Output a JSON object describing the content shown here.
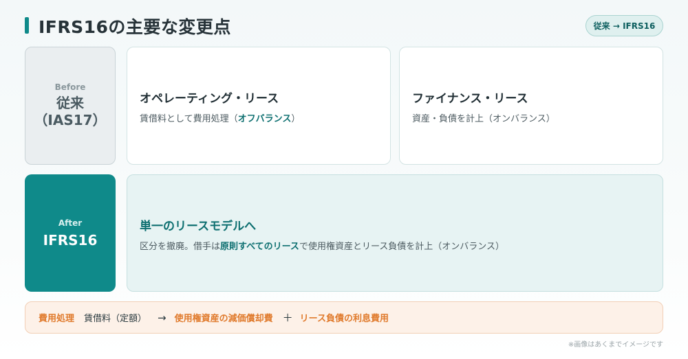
{
  "header": {
    "title": "IFRS16の主要な変更点",
    "badge": "従来 → IFRS16"
  },
  "before": {
    "tag": "Before",
    "label_line1": "従来",
    "label_line2": "（IAS17）",
    "operating": {
      "heading": "オペレーティング・リース",
      "desc_prefix": "賃借料として費用処理（",
      "desc_highlight": "オフバランス",
      "desc_suffix": "）"
    },
    "finance": {
      "heading": "ファイナンス・リース",
      "desc": "資産・負債を計上（オンバランス）"
    }
  },
  "after": {
    "tag": "After",
    "label": "IFRS16",
    "heading": "単一のリースモデルへ",
    "desc_prefix": "区分を撤廃。借手は",
    "desc_highlight": "原則すべてのリース",
    "desc_suffix": "で使用権資産とリース負債を計上（オンバランス）"
  },
  "expense": {
    "label": "費用処理",
    "old": "賃借料（定額）",
    "arrow": "→",
    "item1": "使用権資産の減価償却費",
    "plus": "＋",
    "item2": "リース負債の利息費用"
  },
  "footnote": "※画像はあくまでイメージです",
  "colors": {
    "accent": "#0f8a8a",
    "accent_dark": "#0d6f70",
    "orange": "#e07a2c",
    "before_bg": "#eaeef0",
    "after_panel_bg": "#e7f3f3",
    "strip_bg": "#fdf1e8"
  }
}
